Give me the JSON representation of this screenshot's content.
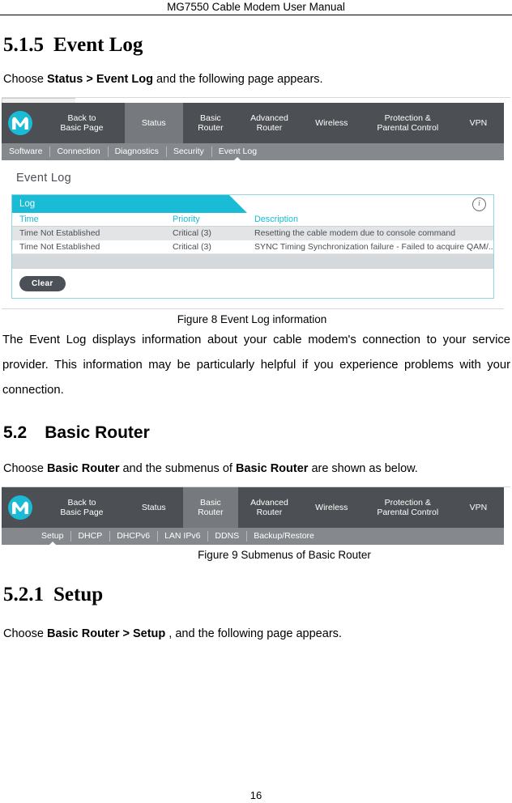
{
  "header": {
    "running_title": "MG7550 Cable Modem User Manual"
  },
  "sections": [
    {
      "number": "5.1.5",
      "title": "Event Log",
      "intro_prefix": "Choose ",
      "intro_bold": "Status > Event Log",
      "intro_suffix": " and the following page appears."
    },
    {
      "number": "5.2",
      "title": "Basic Router",
      "intro_prefix": "Choose ",
      "intro_bold": "Basic Router",
      "intro_middle": " and the submenus of ",
      "intro_bold2": "Basic Router",
      "intro_suffix": " are shown as below."
    },
    {
      "number": "5.2.1",
      "title": "Setup",
      "intro_prefix": "Choose ",
      "intro_bold": "Basic Router > Setup",
      "intro_suffix": " , and the following page appears."
    }
  ],
  "figure8": {
    "caption": "Figure 8 Event Log information",
    "navbar": {
      "logo": "motorola-logo",
      "items": [
        {
          "line1": "Back to",
          "line2": "Basic Page",
          "active": false
        },
        {
          "line1": "Status",
          "line2": "",
          "active": true
        },
        {
          "line1": "Basic",
          "line2": "Router",
          "active": false
        },
        {
          "line1": "Advanced",
          "line2": "Router",
          "active": false
        },
        {
          "line1": "Wireless",
          "line2": "",
          "active": false
        },
        {
          "line1": "Protection &",
          "line2": "Parental Control",
          "active": false
        },
        {
          "line1": "VPN",
          "line2": "",
          "active": false
        }
      ]
    },
    "subnav": [
      {
        "label": "Software",
        "active": false
      },
      {
        "label": "Connection",
        "active": false
      },
      {
        "label": "Diagnostics",
        "active": false
      },
      {
        "label": "Security",
        "active": false
      },
      {
        "label": "Event Log",
        "active": true
      }
    ],
    "panel": {
      "title": "Event Log",
      "tab_label": "Log",
      "info_icon": "info-icon",
      "columns": [
        "Time",
        "Priority",
        "Description"
      ],
      "rows": [
        [
          "Time Not Established",
          "Critical (3)",
          "Resetting the cable modem due to console command"
        ],
        [
          "Time Not Established",
          "Critical (3)",
          "SYNC Timing Synchronization failure - Failed to acquire QAM/..."
        ]
      ],
      "clear_button": "Clear"
    }
  },
  "figure9": {
    "caption": "Figure 9 Submenus of Basic Router",
    "navbar": {
      "logo": "motorola-logo",
      "items": [
        {
          "line1": "Back to",
          "line2": "Basic Page",
          "active": false
        },
        {
          "line1": "Status",
          "line2": "",
          "active": false
        },
        {
          "line1": "Basic",
          "line2": "Router",
          "active": true
        },
        {
          "line1": "Advanced",
          "line2": "Router",
          "active": false
        },
        {
          "line1": "Wireless",
          "line2": "",
          "active": false
        },
        {
          "line1": "Protection &",
          "line2": "Parental Control",
          "active": false
        },
        {
          "line1": "VPN",
          "line2": "",
          "active": false
        }
      ]
    },
    "subnav": [
      {
        "label": "Setup",
        "active": true
      },
      {
        "label": "DHCP",
        "active": false
      },
      {
        "label": "DHCPv6",
        "active": false
      },
      {
        "label": "LAN IPv6",
        "active": false
      },
      {
        "label": "DDNS",
        "active": false
      },
      {
        "label": "Backup/Restore",
        "active": false
      }
    ]
  },
  "body_paragraph": "The Event Log displays information about your cable modem's connection to your service provider. This information may be particularly helpful if you experience problems with your connection.",
  "footer": {
    "page_number": "16"
  },
  "colors": {
    "nav_bg": "#4c4f53",
    "nav_active": "#76797d",
    "subnav_bg": "#85888c",
    "accent_cyan": "#19bcd4",
    "button_dark": "#4c5157"
  }
}
